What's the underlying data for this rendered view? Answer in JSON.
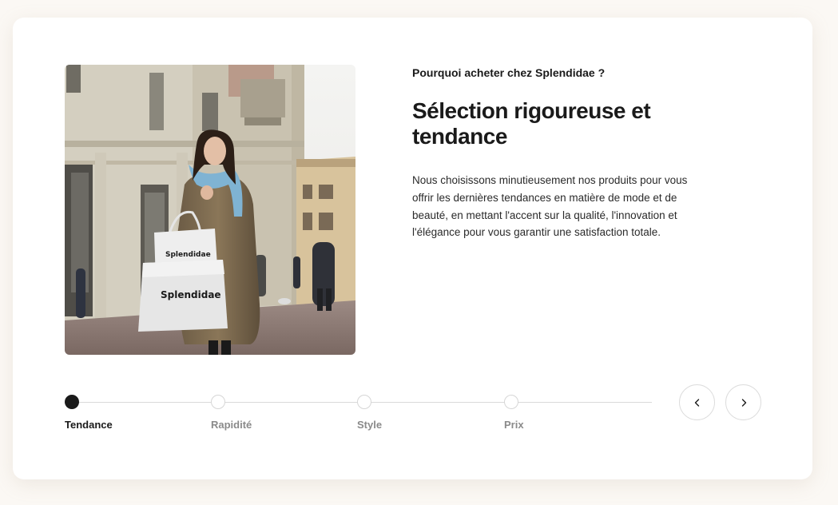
{
  "section": {
    "eyebrow": "Pourquoi acheter chez Splendidae ?",
    "headline": "Sélection rigoureuse et tendance",
    "body": "Nous choisissons minutieusement nos produits pour vous offrir les dernières tendances en matière de mode et de beauté, en mettant l'accent sur la qualité, l'innovation et l'élégance pour vous garantir une satisfaction totale."
  },
  "image": {
    "bag_brand_small": "Splendidae",
    "bag_brand_large": "Splendidae"
  },
  "steps": [
    {
      "label": "Tendance",
      "active": true
    },
    {
      "label": "Rapidité",
      "active": false
    },
    {
      "label": "Style",
      "active": false
    },
    {
      "label": "Prix",
      "active": false
    }
  ],
  "nav": {
    "prev_icon": "chevron-left-icon",
    "next_icon": "chevron-right-icon"
  },
  "colors": {
    "page_background": "#fbf8f4",
    "card_background": "#ffffff",
    "text": "#1a1a1a",
    "inactive_step": "#8a8a8a",
    "track": "#d9d9d9"
  }
}
